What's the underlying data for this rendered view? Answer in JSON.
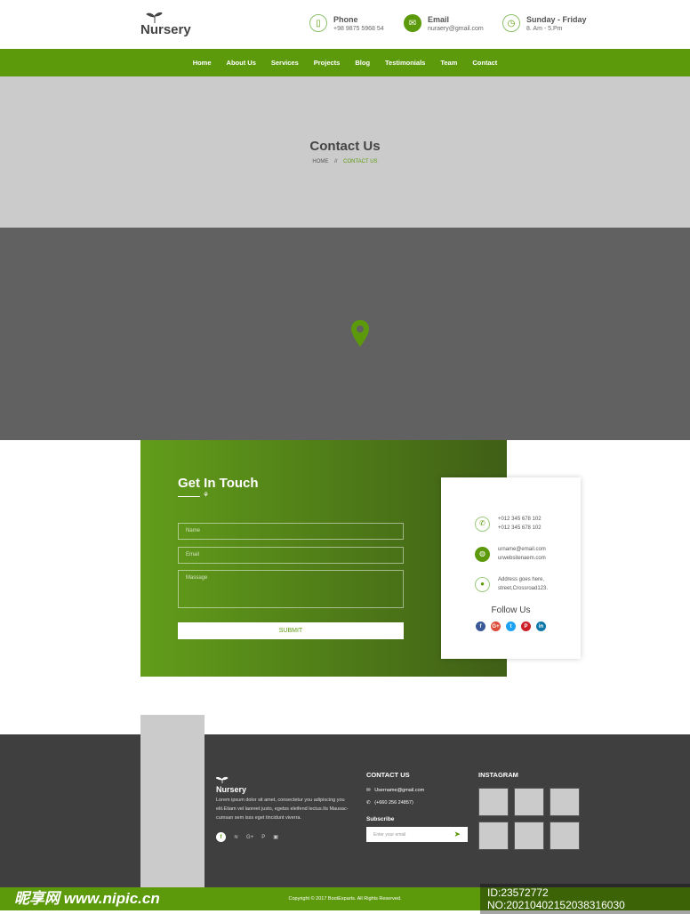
{
  "header": {
    "logo": "Nursery",
    "phone": {
      "title": "Phone",
      "value": "+98 9875 5968 54",
      "icon": "phone-icon"
    },
    "email": {
      "title": "Email",
      "value": "nuraery@gmail.com",
      "icon": "mail-icon"
    },
    "hours": {
      "title": "Sunday - Friday",
      "value": "8. Am - 5.Pm",
      "icon": "clock-icon"
    }
  },
  "nav": [
    "Home",
    "About Us",
    "Services",
    "Projects",
    "Blog",
    "Testimonials",
    "Team",
    "Contact"
  ],
  "banner": {
    "title": "Contact Us",
    "crumb_home": "HOME",
    "crumb_sep": "//",
    "crumb_current": "CONTACT US"
  },
  "form": {
    "title": "Get In Touch",
    "name_placeholder": "Name",
    "email_placeholder": "Email",
    "message_placeholder": "Massage",
    "submit": "SUBMIT"
  },
  "card": {
    "phone1": "+012 345 678 102",
    "phone2": "+012 345 678 102",
    "email": "urname@email.com",
    "website": "urwebsitenaem.com",
    "address1": "Address goes here,",
    "address2": "street,Crossroad123.",
    "follow": "Follow Us",
    "socials": [
      {
        "name": "facebook",
        "glyph": "f",
        "color": "#3b5998"
      },
      {
        "name": "google-plus",
        "glyph": "G+",
        "color": "#dd4b39"
      },
      {
        "name": "twitter",
        "glyph": "t",
        "color": "#1da1f2"
      },
      {
        "name": "pinterest",
        "glyph": "P",
        "color": "#cb2027"
      },
      {
        "name": "linkedin",
        "glyph": "in",
        "color": "#0e76a8"
      }
    ]
  },
  "footer": {
    "logo": "Nursery",
    "about": "Lorem ipsum dolor sit amet, consectetur you adipiscing you elit.Etiam vel laoreet justo, egetss eleifend lectus.Its Mausac-cumsan sem isss eget tincidunt viverra.",
    "contact_title": "CONTACT US",
    "email": "Username@gmail.com",
    "phone": "(+660 256 24857)",
    "subscribe": "Subscribe",
    "subscribe_placeholder": "Enter your email",
    "instagram_title": "INSTAGRAM",
    "copyright": "Copyright © 2017 BootExparts. All Rights Reserved."
  },
  "watermark": {
    "site": "昵享网 www.nipic.cn",
    "id": "ID:23572772 NO:20210402152038316030"
  },
  "colors": {
    "accent": "#5c9a0c",
    "dark": "#3f3f3f"
  }
}
